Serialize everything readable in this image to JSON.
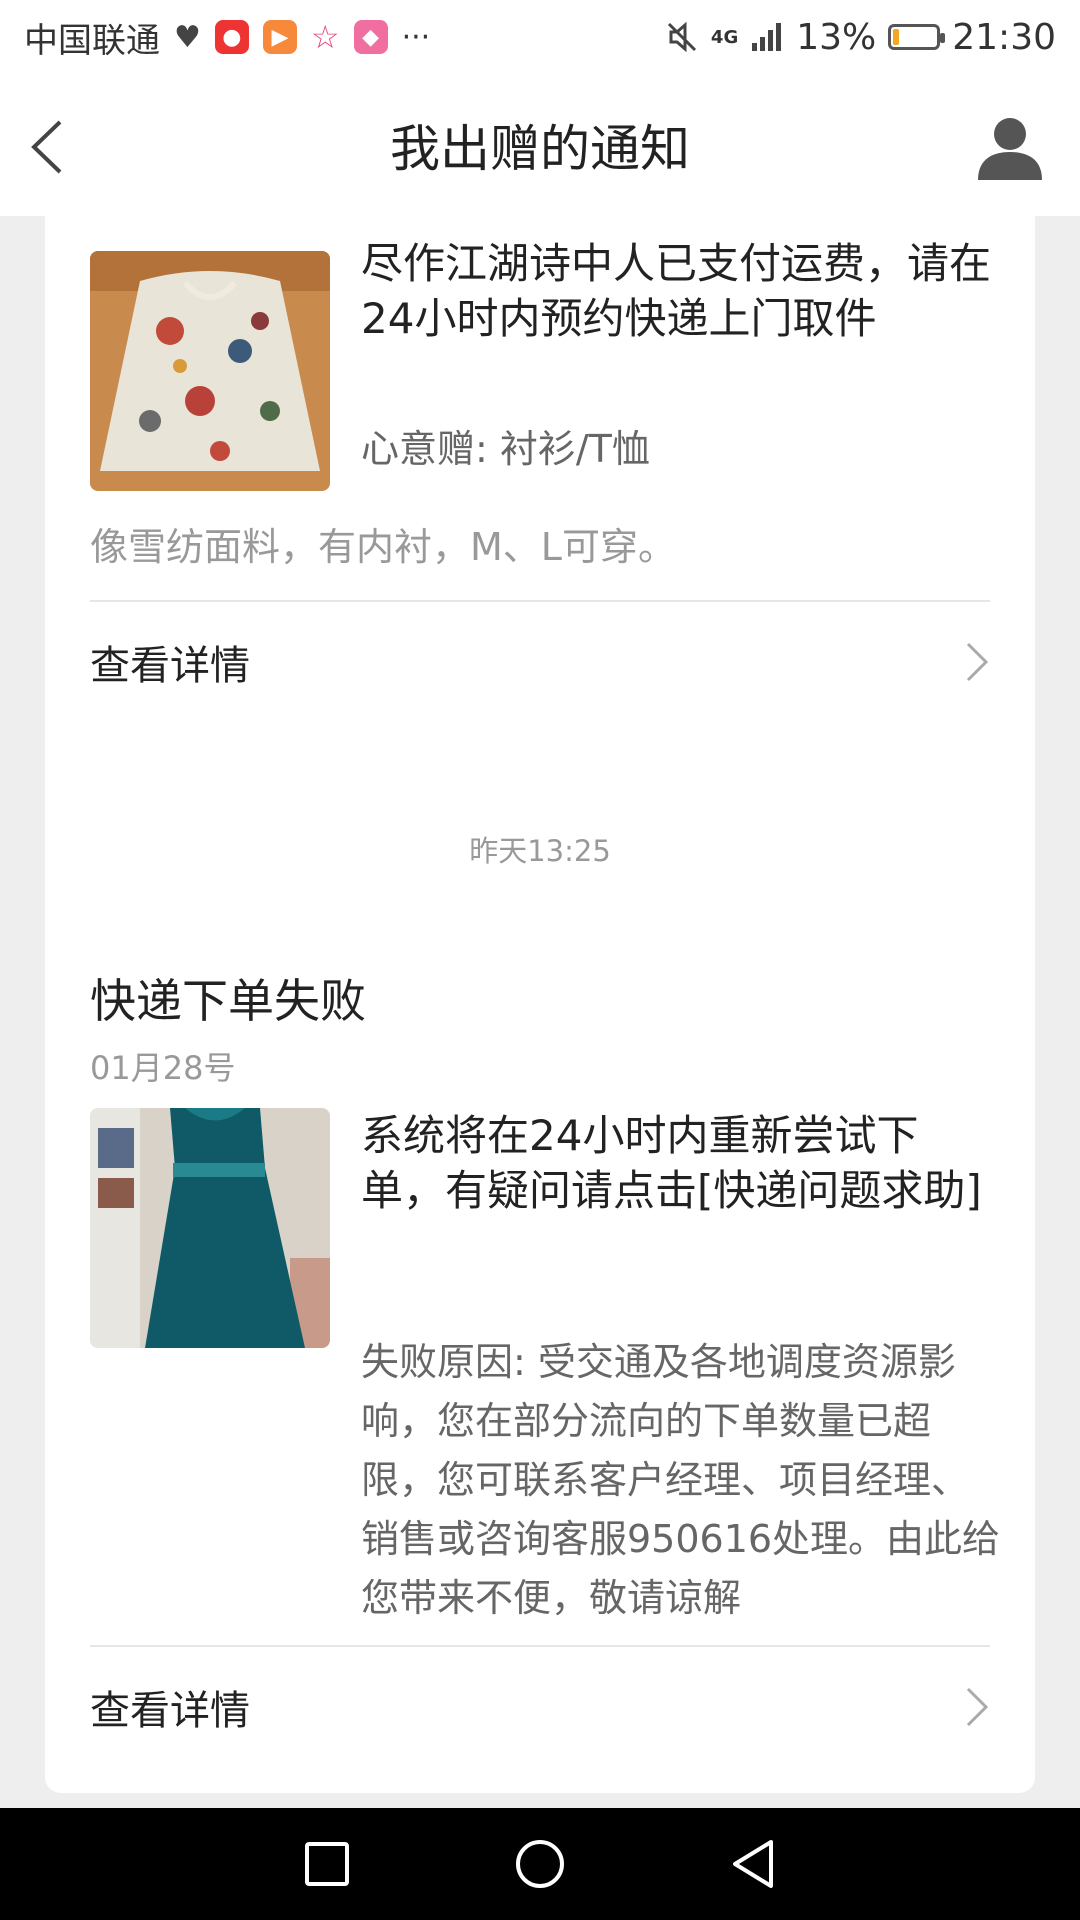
{
  "status_bar": {
    "carrier": "中国联通",
    "more": "···",
    "network": "4G",
    "battery_percent": "13%",
    "battery_level": 0.13,
    "time": "21:30"
  },
  "header": {
    "title": "我出赠的通知"
  },
  "notifications": [
    {
      "message": "尽作江湖诗中人已支付运费，请在24小时内预约快递上门取件",
      "category": "心意赠: 衬衫/T恤",
      "description": "像雪纺面料，有内衬，M、L可穿。",
      "detail_label": "查看详情"
    },
    {
      "timestamp": "昨天13:25",
      "title": "快递下单失败",
      "date": "01月28号",
      "message": "系统将在24小时内重新尝试下单，有疑问请点击[快递问题求助]",
      "reason": "失败原因: 受交通及各地调度资源影响，您在部分流向的下单数量已超限，您可联系客户经理、项目经理、销售或咨询客服950616处理。由此给您带来不便，敬请谅解",
      "detail_label": "查看详情"
    }
  ],
  "colors": {
    "background": "#eeeeee",
    "card": "#ffffff",
    "battery": "#f5a623"
  }
}
